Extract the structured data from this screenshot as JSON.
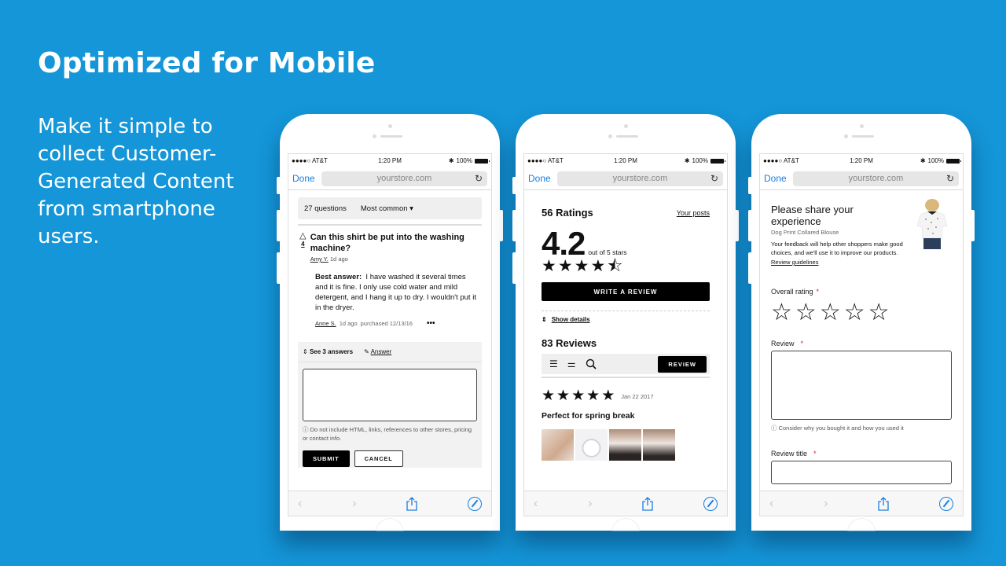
{
  "slide": {
    "headline": "Optimized for Mobile",
    "subtext": "Make it simple to collect Customer-Generated Content from smartphone users."
  },
  "browser": {
    "carrier": "●●●●○ AT&T",
    "wifi_icon": "wifi-icon",
    "time": "1:20 PM",
    "bluetooth_icon": "✱",
    "battery_label": "100%",
    "done_label": "Done",
    "url": "yourstore.com",
    "reload_icon": "↻",
    "back_icon": "‹",
    "forward_icon": "›"
  },
  "phone_qa": {
    "question_count": "27 questions",
    "sort_label": "Most common",
    "sort_caret": "▾",
    "question": {
      "votes": "4",
      "text": "Can this shirt be put into the washing machine?",
      "author": "Amy Y.",
      "age": "1d ago"
    },
    "best_answer_label": "Best answer:",
    "best_answer_text": "I have washed it several times and it is fine. I only use cold water and mild detergent, and I hang it up to dry. I wouldn't put it in the dryer.",
    "answer_author": "Anne S.",
    "answer_age": "1d ago",
    "answer_purchased": "purchased 12/13/16",
    "more_label": "•••",
    "see_answers": "See 3 answers",
    "answer_link": "Answer",
    "answer_value": "",
    "hint": "Do not include HTML, links, references to other stores, pricing or contact info.",
    "submit_label": "SUBMIT",
    "cancel_label": "CANCEL"
  },
  "phone_ratings": {
    "ratings_title": "56 Ratings",
    "your_posts": "Your posts",
    "average": "4.2",
    "out_of": "out of 5 stars",
    "average_stars": 4.5,
    "stars_display": [
      "★",
      "★",
      "★",
      "★",
      "⯪"
    ],
    "write_review": "WRITE A REVIEW",
    "show_details": "Show details",
    "reviews_title": "83 Reviews",
    "review_button": "REVIEW",
    "review": {
      "rating": 5,
      "stars": [
        "★",
        "★",
        "★",
        "★",
        "★"
      ],
      "date": "Jan 22 2017",
      "title": "Perfect for spring break",
      "photos": 4
    }
  },
  "phone_form": {
    "title": "Please share your experience",
    "product": "Dog Print Collared Blouse",
    "description": "Your feedback will help other shoppers make good choices, and we'll use it to improve our products.",
    "guidelines": "Review guidelines",
    "overall_rating_label": "Overall rating",
    "required_mark": "*",
    "rating_value": 0,
    "empty_stars": [
      "☆",
      "☆",
      "☆",
      "☆",
      "☆"
    ],
    "review_label": "Review",
    "review_value": "",
    "review_hint": "Consider why you bought it and how you used it",
    "review_title_label": "Review title",
    "review_title_value": ""
  },
  "colors": {
    "background": "#1496d8",
    "link_blue": "#1a7ee0",
    "required_red": "#e01a1a",
    "button_black": "#000000"
  }
}
